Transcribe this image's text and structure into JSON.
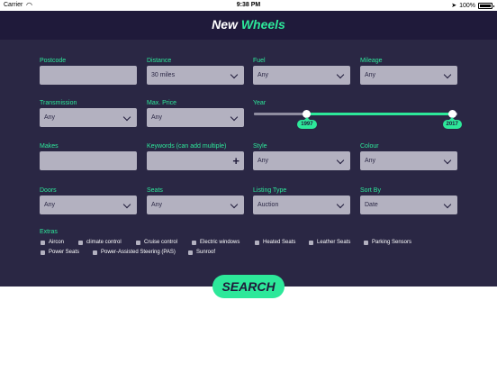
{
  "statusbar": {
    "carrier": "Carrier",
    "time": "9:38 PM",
    "battery": "100%"
  },
  "header": {
    "title_part1": "New",
    "title_part2": "Wheels"
  },
  "fields": {
    "postcode": {
      "label": "Postcode",
      "value": ""
    },
    "distance": {
      "label": "Distance",
      "value": "30 miles"
    },
    "fuel": {
      "label": "Fuel",
      "value": "Any"
    },
    "mileage": {
      "label": "Mileage",
      "value": "Any"
    },
    "transmission": {
      "label": "Transmission",
      "value": "Any"
    },
    "max_price": {
      "label": "Max. Price",
      "value": "Any"
    },
    "year": {
      "label": "Year",
      "min": "1997",
      "max": "2017",
      "low_fraction": 0.26,
      "high_fraction": 1.0
    },
    "makes": {
      "label": "Makes",
      "value": ""
    },
    "keywords": {
      "label": "Keywords (can add multiple)",
      "value": "",
      "add": "+"
    },
    "style": {
      "label": "Style",
      "value": "Any"
    },
    "colour": {
      "label": "Colour",
      "value": "Any"
    },
    "doors": {
      "label": "Doors",
      "value": "Any"
    },
    "seats": {
      "label": "Seats",
      "value": "Any"
    },
    "listing_type": {
      "label": "Listing Type",
      "value": "Auction"
    },
    "sort_by": {
      "label": "Sort By",
      "value": "Date"
    }
  },
  "extras": {
    "label": "Extras",
    "items": [
      "Aircon",
      "climate control",
      "Cruise control",
      "Electric windows",
      "Heated Seats",
      "Leather Seats",
      "Parking Sensors",
      "Power Seats",
      "Power-Assisted Steering (PAS)",
      "Sunroof"
    ]
  },
  "search_label": "SEARCH",
  "colors": {
    "panel": "#2a2744",
    "header": "#1f1a3a",
    "accent": "#2de89a",
    "input": "#b3b1c0"
  }
}
